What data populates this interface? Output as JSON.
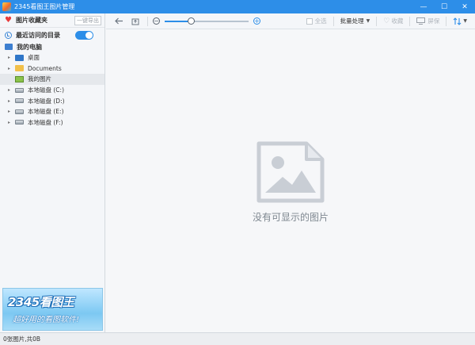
{
  "window": {
    "title": "2345看图王图片管理",
    "controls": {
      "minimize": "—",
      "maximize": "☐",
      "close": "✕"
    }
  },
  "sidebar": {
    "favorites": {
      "title": "图片收藏夹",
      "export_label": "一键导出",
      "icon": "heart-icon"
    },
    "recent": {
      "label": "最近访问的目录",
      "toggle_on": true
    },
    "computer": {
      "label": "我的电脑"
    },
    "tree": [
      {
        "label": "桌面",
        "icon": "desktop-icon",
        "selected": false
      },
      {
        "label": "Documents",
        "icon": "folder-icon",
        "selected": false
      },
      {
        "label": "我的图片",
        "icon": "pictures-icon",
        "selected": true
      },
      {
        "label": "本地磁盘 (C:)",
        "icon": "drive-icon",
        "selected": false
      },
      {
        "label": "本地磁盘 (D:)",
        "icon": "drive-icon",
        "selected": false
      },
      {
        "label": "本地磁盘 (E:)",
        "icon": "drive-icon",
        "selected": false
      },
      {
        "label": "本地磁盘 (F:)",
        "icon": "drive-icon",
        "selected": false
      }
    ],
    "ad": {
      "title": "2345看图王",
      "slogan": "超好用的看图软件!"
    }
  },
  "toolbar": {
    "select_all": "全选",
    "batch": "批量处理",
    "favorite": "收藏",
    "projector": "屏保",
    "zoom_fraction": 0.32
  },
  "content": {
    "empty_message": "没有可显示的图片"
  },
  "statusbar": {
    "text": "0张图片,共0B"
  },
  "colors": {
    "accent": "#2d8ee8",
    "titlebar": "#2d8ee8"
  }
}
